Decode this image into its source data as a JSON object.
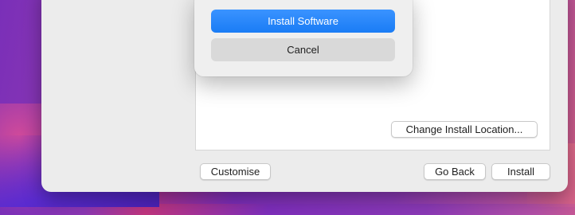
{
  "dialog": {
    "primary_button": "Install Software",
    "secondary_button": "Cancel"
  },
  "installer": {
    "change_location_button": "Change Install Location...",
    "customise_button": "Customise",
    "go_back_button": "Go Back",
    "install_button": "Install"
  },
  "colors": {
    "accent": "#1a7cf5",
    "window_bg": "#ececec"
  }
}
